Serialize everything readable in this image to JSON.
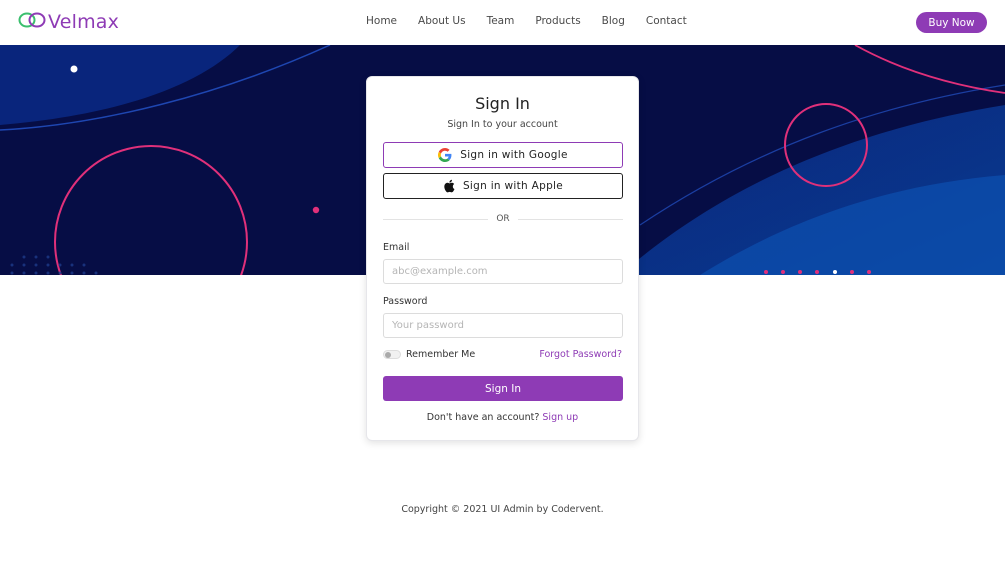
{
  "brand": {
    "name": "Velmax",
    "accent": "#8e3bb5"
  },
  "nav": {
    "links": [
      "Home",
      "About Us",
      "Team",
      "Products",
      "Blog",
      "Contact"
    ],
    "cta": "Buy Now"
  },
  "hero": {
    "background": "#060d45",
    "circle_color": "#e0307a"
  },
  "signin": {
    "title": "Sign In",
    "subtitle": "Sign In to your account",
    "google_label": "Sign in with Google",
    "apple_label": "Sign in with Apple",
    "divider": "OR",
    "email_label": "Email",
    "email_placeholder": "abc@example.com",
    "email_value": "",
    "password_label": "Password",
    "password_placeholder": "Your password",
    "password_value": "",
    "remember_label": "Remember Me",
    "remember_checked": false,
    "forgot_label": "Forgot Password?",
    "submit_label": "Sign In",
    "signup_prompt": "Don't have an account?",
    "signup_link": "Sign up"
  },
  "footer": {
    "copyright": "Copyright © 2021 UI Admin by Codervent."
  }
}
